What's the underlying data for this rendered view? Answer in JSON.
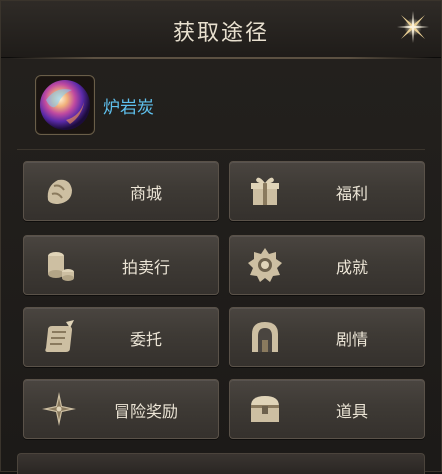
{
  "dialog": {
    "title": "获取途径"
  },
  "item": {
    "name": "炉岩炭"
  },
  "sources": [
    {
      "label": "商城",
      "icon": "mall-pouch-icon"
    },
    {
      "label": "福利",
      "icon": "gift-box-icon"
    },
    {
      "label": "拍卖行",
      "icon": "coin-stack-icon"
    },
    {
      "label": "成就",
      "icon": "achievement-medal-icon"
    },
    {
      "label": "委托",
      "icon": "scroll-quest-icon"
    },
    {
      "label": "剧情",
      "icon": "story-gate-icon"
    },
    {
      "label": "冒险奖励",
      "icon": "compass-star-icon"
    },
    {
      "label": "道具",
      "icon": "treasure-chest-icon"
    }
  ],
  "colors": {
    "item_name": "#5fc1ee",
    "label": "#ece5d6",
    "accent_gold": "#c9a468"
  }
}
